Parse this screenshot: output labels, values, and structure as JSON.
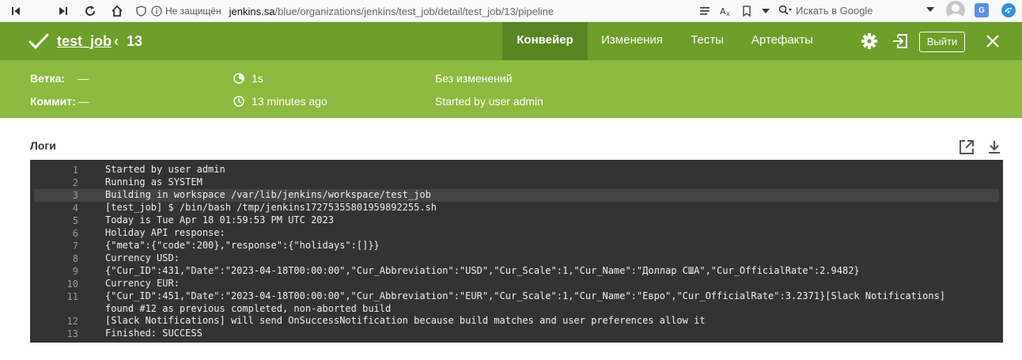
{
  "browser": {
    "insecure_label": "Не защищён",
    "url_host": "jenkins.sa",
    "url_path": "/blue/organizations/jenkins/test_job/detail/test_job/13/pipeline",
    "search_placeholder": "Искать в Google"
  },
  "header": {
    "job_name": "test_job",
    "separator": "‹",
    "run_number": "13",
    "tabs": [
      {
        "label": "Конвейер",
        "active": true
      },
      {
        "label": "Изменения",
        "active": false
      },
      {
        "label": "Тесты",
        "active": false
      },
      {
        "label": "Артефакты",
        "active": false
      }
    ],
    "logout_label": "Выйти"
  },
  "summary": {
    "branch_label": "Ветка:",
    "branch_value": "—",
    "commit_label": "Коммит:",
    "commit_value": "—",
    "duration": "1s",
    "time_ago": "13 minutes ago",
    "changes": "Без изменений",
    "started_by": "Started by user admin"
  },
  "logs": {
    "title": "Логи",
    "lines": [
      {
        "n": "1",
        "text": "Started by user admin"
      },
      {
        "n": "2",
        "text": "Running as SYSTEM"
      },
      {
        "n": "3",
        "text": "Building in workspace /var/lib/jenkins/workspace/test_job"
      },
      {
        "n": "4",
        "text": "[test_job] $ /bin/bash /tmp/jenkins1727535580195989​2255.sh"
      },
      {
        "n": "5",
        "text": "Today is Tue Apr 18 01:59:53 PM UTC 2023"
      },
      {
        "n": "6",
        "text": "Holiday API response:"
      },
      {
        "n": "7",
        "text": "{\"meta\":{\"code\":200},\"response\":{\"holidays\":[]}}"
      },
      {
        "n": "8",
        "text": "Currency USD:"
      },
      {
        "n": "9",
        "text": "{\"Cur_ID\":431,\"Date\":\"2023-04-18T00:00:00\",\"Cur_Abbreviation\":\"USD\",\"Cur_Scale\":1,\"Cur_Name\":\"Доллар США\",\"Cur_OfficialRate\":2.9482}"
      },
      {
        "n": "10",
        "text": "Currency EUR:"
      },
      {
        "n": "11",
        "text": "{\"Cur_ID\":451,\"Date\":\"2023-04-18T00:00:00\",\"Cur_Abbreviation\":\"EUR\",\"Cur_Scale\":1,\"Cur_Name\":\"Евро\",\"Cur_OfficialRate\":3.2371}[Slack Notifications]\nfound #12 as previous completed, non-aborted build"
      },
      {
        "n": "12",
        "text": "[Slack Notifications] will send OnSuccessNotification because build matches and user preferences allow it"
      },
      {
        "n": "13",
        "text": "Finished: SUCCESS"
      }
    ]
  },
  "colors": {
    "header": "#6e9f2a",
    "header_active_tab": "#578522",
    "summary": "#8cb93f",
    "console": "#333333"
  }
}
